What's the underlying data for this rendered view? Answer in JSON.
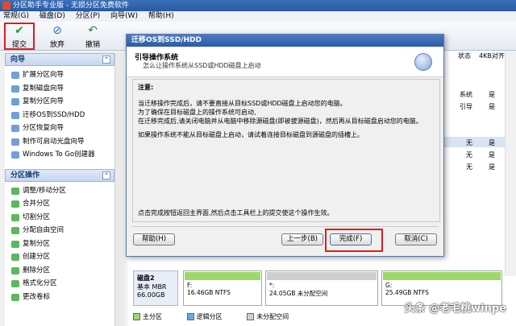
{
  "window": {
    "title": "分区助手专业版 - 无损分区免费软件"
  },
  "menubar": {
    "items": [
      "常规(G)",
      "磁盘(D)",
      "分区(P)",
      "向导(W)",
      "帮助(H)"
    ]
  },
  "toolbar": {
    "submit": "提交",
    "discard": "放弃",
    "undo": "撤销"
  },
  "wizard_panel": {
    "title": "向导",
    "items": [
      "扩展分区向导",
      "复制磁盘向导",
      "复制分区向导",
      "迁移OS到SSD/HDD",
      "分区恢复向导",
      "制作可启动光盘向导",
      "Windows To Go创建器"
    ]
  },
  "partition_ops": {
    "title": "分区操作",
    "items": [
      "调整/移动分区",
      "合并分区",
      "切割分区",
      "分配自由空间",
      "复制分区",
      "创建分区",
      "删除分区",
      "格式化分区",
      "更改卷标"
    ]
  },
  "table": {
    "headers": [
      "状态",
      "4KB对齐"
    ],
    "rows": [
      {
        "status": "系统",
        "align": "是"
      },
      {
        "status": "引导",
        "align": "是"
      },
      {
        "status": "无",
        "align": "是"
      },
      {
        "status": "无",
        "align": "是"
      },
      {
        "status": "无",
        "align": "是"
      }
    ]
  },
  "disk2": {
    "name": "磁盘2",
    "type": "基本 MBR",
    "size": "66.00GB",
    "partitions": [
      {
        "label": "F:",
        "info": "16.46GB NTFS"
      },
      {
        "label": "*:",
        "info": "24.05GB 未分配空间"
      },
      {
        "label": "G:",
        "info": "25.49GB NTFS"
      }
    ]
  },
  "legend": {
    "primary": "主分区",
    "logical": "逻辑分区",
    "unallocated": "未分配空间"
  },
  "watermark": "头条 @老毛桃winpe",
  "dialog": {
    "title": "迁移OS到SSD/HDD",
    "heading": "引导操作系统",
    "subheading": "怎么让操作系统从SSD或HDD磁盘上启动",
    "note_title": "注意:",
    "note_lines": [
      "当迁移操作完成后，请不要直接从目标SSD或HDD磁盘上启动您的电脑。",
      "为了确保在目标磁盘上的操作系统可启动,",
      "在迁移完成后,请关闭电脑并从电脑中移除源磁盘(即被拔源磁盘)，然后再从目标磁盘启动您的电脑。"
    ],
    "note_extra": "如果操作系统不能从目标磁盘上启动，请试着连接目标磁盘到源磁盘的插槽上。",
    "footer_text": "点击完成按钮返回主界面,然后点击工具栏上的提交使这个操作生效。",
    "help_btn": "帮助(H)",
    "back_btn": "上一步(B)",
    "finish_btn": "完成(F)",
    "cancel_btn": "取消(C)"
  },
  "colors": {
    "highlight": "#e01b1b",
    "primary_partition": "#9ed76a",
    "logical_partition": "#6ca8e0",
    "unallocated": "#cfcfcf"
  }
}
